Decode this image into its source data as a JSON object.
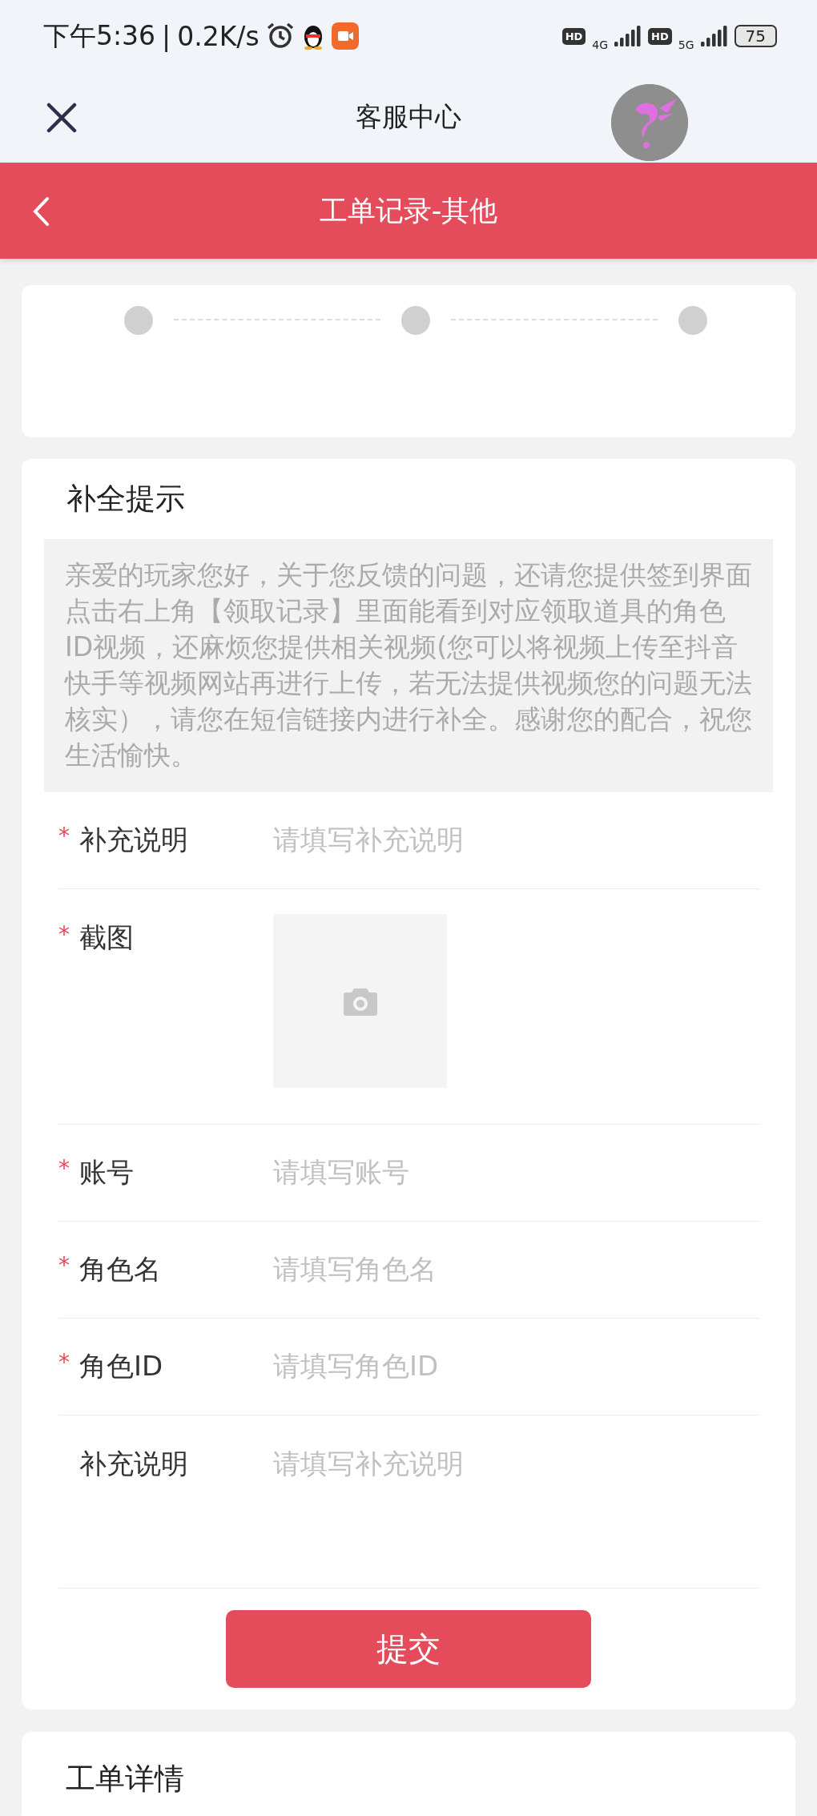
{
  "status_bar": {
    "time": "下午5:36",
    "separator": "|",
    "speed": "0.2K/s",
    "sim1": {
      "badge": "HD",
      "network": "4G"
    },
    "sim2": {
      "badge": "HD",
      "network": "5G"
    },
    "battery": "75"
  },
  "nav": {
    "title": "客服中心"
  },
  "header": {
    "title": "工单记录-其他"
  },
  "notice": {
    "title": "补全提示",
    "text": "亲爱的玩家您好，关于您反馈的问题，还请您提供签到界面点击右上角【领取记录】里面能看到对应领取道具的角色ID视频，还麻烦您提供相关视频(您可以将视频上传至抖音快手等视频网站再进行上传，若无法提供视频您的问题无法核实），请您在短信链接内进行补全。感谢您的配合，祝您生活愉快。"
  },
  "fields": [
    {
      "kind": "text",
      "required_mark": "*",
      "label": "补充说明",
      "placeholder": "请填写补充说明"
    },
    {
      "kind": "upload",
      "required_mark": "*",
      "label": "截图"
    },
    {
      "kind": "text",
      "required_mark": "*",
      "label": "账号",
      "placeholder": "请填写账号"
    },
    {
      "kind": "text",
      "required_mark": "*",
      "label": "角色名",
      "placeholder": "请填写角色名"
    },
    {
      "kind": "text",
      "required_mark": "*",
      "label": "角色ID",
      "placeholder": "请填写角色ID"
    },
    {
      "kind": "textarea",
      "label": "补充说明",
      "placeholder": "请填写补充说明"
    }
  ],
  "submit": "提交",
  "details": {
    "title": "工单详情"
  }
}
